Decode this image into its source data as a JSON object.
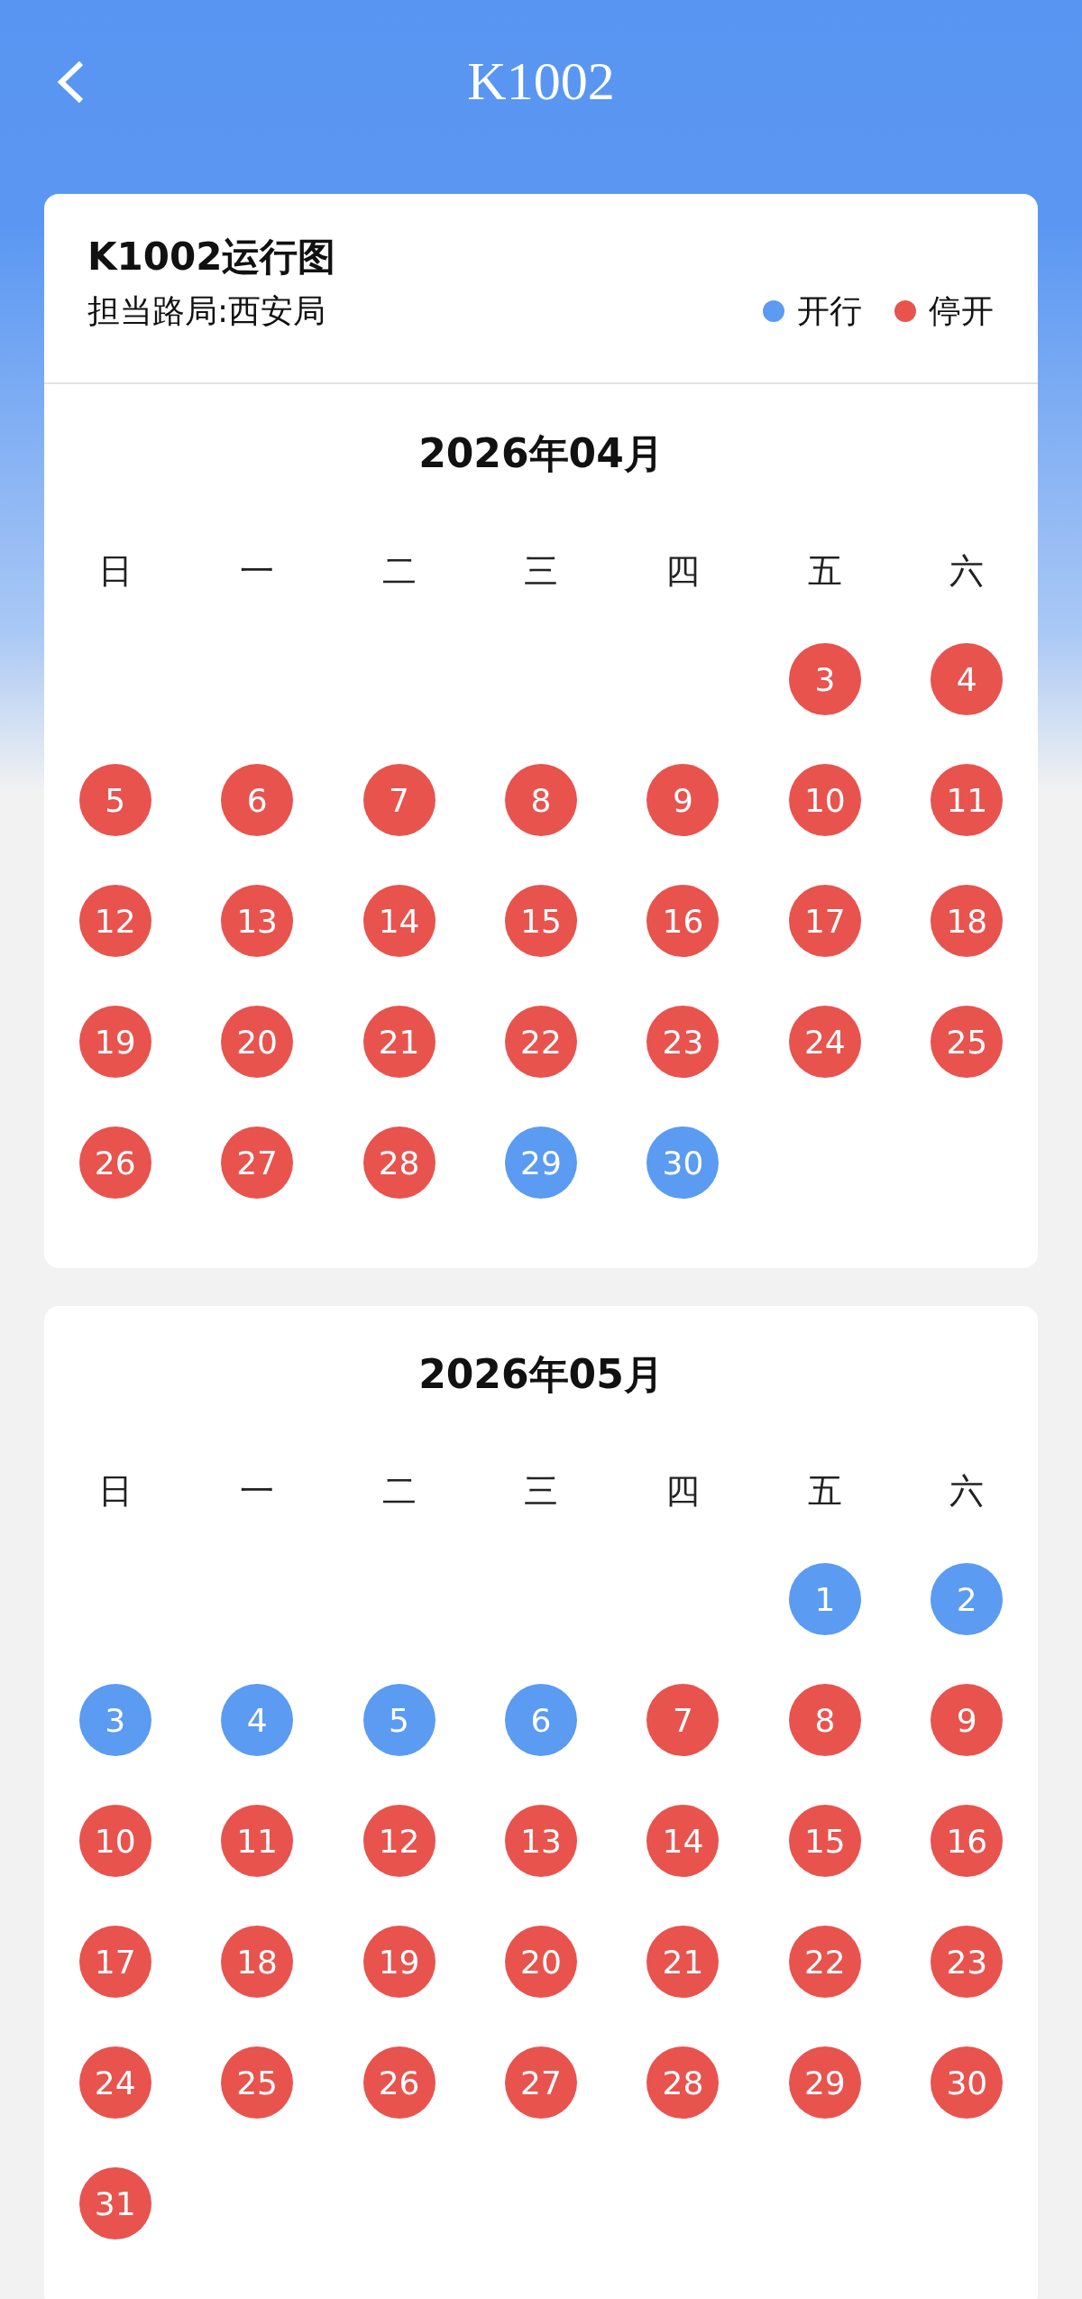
{
  "app_bar": {
    "title": "K1002"
  },
  "info": {
    "title": "K1002运行图",
    "bureau": "担当路局:西安局",
    "legend": [
      {
        "label": "开行",
        "color": "#5b9bf1"
      },
      {
        "label": "停开",
        "color": "#e8534e"
      }
    ]
  },
  "months": [
    {
      "title": "2026年04月",
      "weekdays": [
        "日",
        "一",
        "二",
        "三",
        "四",
        "五",
        "六"
      ],
      "weeks": [
        [
          {
            "day": "3",
            "running": false
          },
          {
            "day": "4",
            "running": false
          }
        ],
        [
          {
            "day": "5",
            "running": false
          },
          {
            "day": "6",
            "running": false
          },
          {
            "day": "7",
            "running": false
          },
          {
            "day": "8",
            "running": false
          },
          {
            "day": "9",
            "running": false
          },
          {
            "day": "10",
            "running": false
          },
          {
            "day": "11",
            "running": false
          }
        ],
        [
          {
            "day": "12",
            "running": false
          },
          {
            "day": "13",
            "running": false
          },
          {
            "day": "14",
            "running": false
          },
          {
            "day": "15",
            "running": false
          },
          {
            "day": "16",
            "running": false
          },
          {
            "day": "17",
            "running": false
          },
          {
            "day": "18",
            "running": false
          }
        ],
        [
          {
            "day": "19",
            "running": false
          },
          {
            "day": "20",
            "running": false
          },
          {
            "day": "21",
            "running": false
          },
          {
            "day": "22",
            "running": false
          },
          {
            "day": "23",
            "running": false
          },
          {
            "day": "24",
            "running": false
          },
          {
            "day": "25",
            "running": false
          }
        ],
        [
          {
            "day": "26",
            "running": false
          },
          {
            "day": "27",
            "running": false
          },
          {
            "day": "28",
            "running": false
          },
          {
            "day": "29",
            "running": true
          },
          {
            "day": "30",
            "running": true
          }
        ]
      ]
    },
    {
      "title": "2026年05月",
      "weekdays": [
        "日",
        "一",
        "二",
        "三",
        "四",
        "五",
        "六"
      ],
      "weeks": [
        [
          {
            "day": "1",
            "running": true
          },
          {
            "day": "2",
            "running": true
          }
        ],
        [
          {
            "day": "3",
            "running": true
          },
          {
            "day": "4",
            "running": true
          },
          {
            "day": "5",
            "running": true
          },
          {
            "day": "6",
            "running": true
          },
          {
            "day": "7",
            "running": false
          },
          {
            "day": "8",
            "running": false
          },
          {
            "day": "9",
            "running": false
          }
        ],
        [
          {
            "day": "10",
            "running": false
          },
          {
            "day": "11",
            "running": false
          },
          {
            "day": "12",
            "running": false
          },
          {
            "day": "13",
            "running": false
          },
          {
            "day": "14",
            "running": false
          },
          {
            "day": "15",
            "running": false
          },
          {
            "day": "16",
            "running": false
          }
        ],
        [
          {
            "day": "17",
            "running": false
          },
          {
            "day": "18",
            "running": false
          },
          {
            "day": "19",
            "running": false
          },
          {
            "day": "20",
            "running": false
          },
          {
            "day": "21",
            "running": false
          },
          {
            "day": "22",
            "running": false
          },
          {
            "day": "23",
            "running": false
          }
        ],
        [
          {
            "day": "24",
            "running": false
          },
          {
            "day": "25",
            "running": false
          },
          {
            "day": "26",
            "running": false
          },
          {
            "day": "27",
            "running": false
          },
          {
            "day": "28",
            "running": false
          },
          {
            "day": "29",
            "running": false
          },
          {
            "day": "30",
            "running": false
          }
        ],
        [
          {
            "day": "31",
            "running": false
          }
        ]
      ]
    }
  ]
}
